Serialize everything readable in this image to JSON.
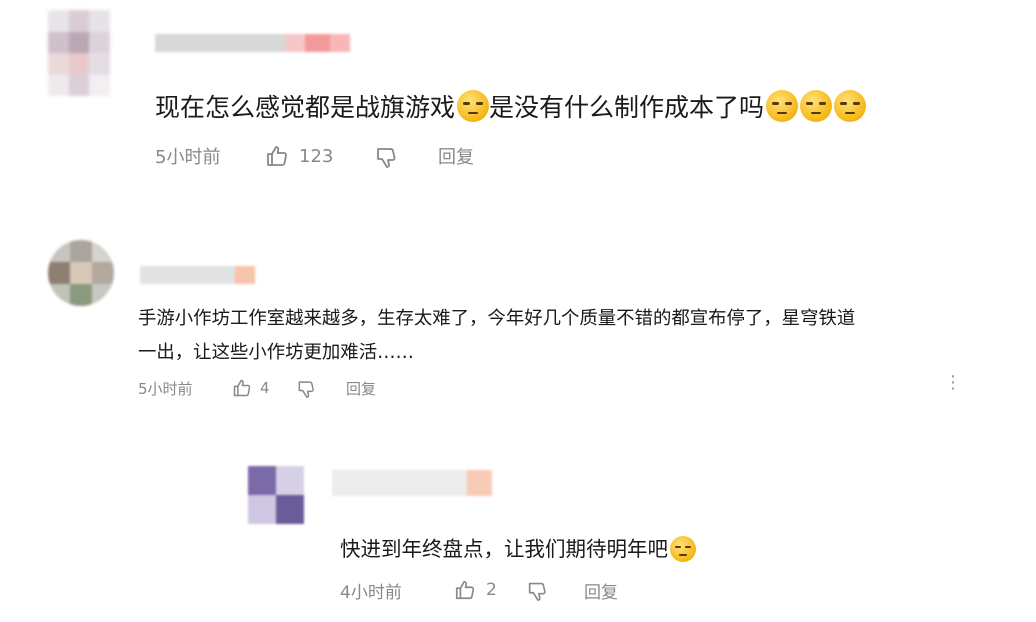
{
  "comments": [
    {
      "text_before_emoji": "现在怎么感觉都是战旗游戏",
      "text_after_emoji": "是没有什么制作成本了吗",
      "time": "5小时前",
      "likes": "123",
      "reply_label": "回复"
    },
    {
      "text_line1": "手游小作坊工作室越来越多，生存太难了，今年好几个质量不错的都宣布停了，星穹铁道",
      "text_line2": "一出，让这些小作坊更加难活……",
      "time": "5小时前",
      "likes": "4",
      "reply_label": "回复"
    },
    {
      "text": "快进到年终盘点，让我们期待明年吧",
      "time": "4小时前",
      "likes": "2",
      "reply_label": "回复"
    }
  ],
  "icons": {
    "like": "thumbs-up-icon",
    "dislike": "thumbs-down-icon",
    "more": "more-vertical-icon"
  },
  "colors": {
    "emoji_yellow": "#f5b614",
    "meta_gray": "#888888"
  }
}
